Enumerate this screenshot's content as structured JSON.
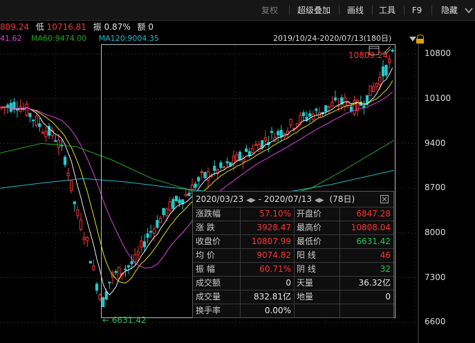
{
  "toolbar": {
    "buttons": [
      "复权",
      "超级叠加",
      "画线",
      "工具",
      "F9",
      "隐藏"
    ]
  },
  "stats_bar": {
    "high_value": "809.24",
    "low_label": "低",
    "low_value": "10716.81",
    "amp_label": "振",
    "amp_value": "0.87%",
    "amount_label": "额",
    "amount_value": "0"
  },
  "ma_bar": {
    "ma_partial": "41.62",
    "ma60": "MA60:9474.00",
    "ma120": "MA120:9004.35"
  },
  "date_range": "2019/10/24-2020/07/13(180日)",
  "y_axis": [
    "10800",
    "10100",
    "9400",
    "8700",
    "8000",
    "7300",
    "6600"
  ],
  "annotations": {
    "min": "6631.42",
    "max": "10809.24"
  },
  "stats_panel": {
    "title": "2020/03/23",
    "title_to": "2020/07/13",
    "days": "(78日)",
    "rows": [
      {
        "l1": "涨跌幅",
        "v1": "57.10%",
        "l2": "开盘价",
        "v2": "6847.28"
      },
      {
        "l1": "涨 跌",
        "v1": "3928.47",
        "l2": "最高价",
        "v2": "10808.04"
      },
      {
        "l1": "收盘价",
        "v1": "10807.99",
        "l2": "最低价",
        "v2": "6631.42"
      },
      {
        "l1": "均 价",
        "v1": "9074.82",
        "l2": "阳 线",
        "v2": "46"
      },
      {
        "l1": "振 幅",
        "v1": "60.71%",
        "l2": "阴 线",
        "v2": "32"
      },
      {
        "l1": "成交额",
        "v1": "0",
        "l2": "天量",
        "v2": "36.32亿"
      },
      {
        "l1": "成交量",
        "v1": "832.81亿",
        "l2": "地量",
        "v2": "0"
      },
      {
        "l1": "换手率",
        "v1": "0.00%",
        "l2": "",
        "v2": ""
      }
    ]
  },
  "chart_data": {
    "type": "line",
    "x_range": [
      "2019/10/24",
      "2020/07/13"
    ],
    "y_ticks": [
      10800,
      10100,
      9400,
      8700,
      8000,
      7300,
      6600
    ],
    "series": [
      {
        "name": "MA60",
        "color": "#22aa22"
      },
      {
        "name": "MA120",
        "color": "#22bbcc"
      }
    ],
    "low": 6631.42,
    "high": 10809.24
  },
  "colors": {
    "up": "#ff3333",
    "down": "#22cccc",
    "ma5": "#f0f0f0",
    "ma10": "#e6e600",
    "ma20": "#e040e0",
    "ma60": "#22aa22",
    "ma120": "#22bbcc"
  }
}
